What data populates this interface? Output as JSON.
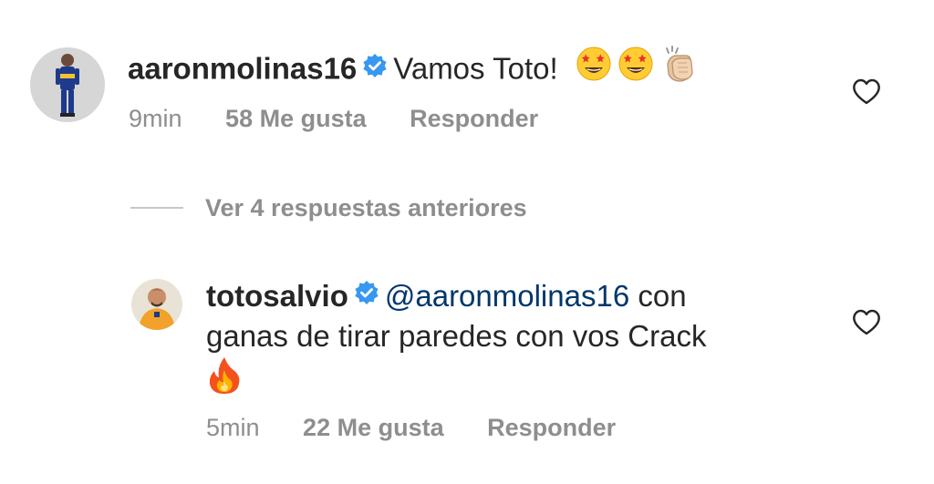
{
  "comment": {
    "username": "aaronmolinas16",
    "text": "Vamos Toto!",
    "emojis": [
      "star-struck-emoji",
      "star-struck-emoji",
      "clapping-hands-emoji"
    ],
    "time": "9min",
    "likes": "58 Me gusta",
    "reply_label": "Responder"
  },
  "view_replies": {
    "label": "Ver 4 respuestas anteriores"
  },
  "reply": {
    "username": "totosalvio",
    "mention": "@aaronmolinas16",
    "text_line1": " con",
    "text_line2": "ganas de tirar paredes con vos Crack",
    "emojis": [
      "fire-emoji"
    ],
    "time": "5min",
    "likes": "22 Me gusta",
    "reply_label": "Responder"
  },
  "colors": {
    "text": "#262626",
    "secondary": "#8e8e8e",
    "verified": "#3897f0",
    "mention": "#00376b",
    "divider": "#c7c7c7"
  }
}
